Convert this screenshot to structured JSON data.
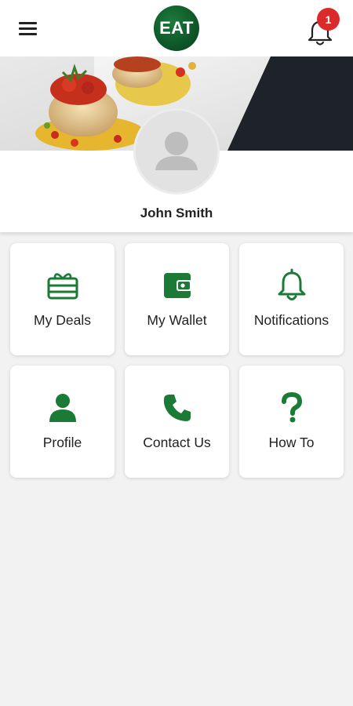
{
  "header": {
    "menu_icon": "hamburger-menu-icon",
    "logo_text": "EAT",
    "notification_icon": "bell-icon",
    "notification_count": "1",
    "accent_color": "#0f5a2a",
    "badge_color": "#d92b2b"
  },
  "profile": {
    "avatar_icon": "person-placeholder-icon",
    "name": "John Smith"
  },
  "menu": {
    "icon_color": "#1b7a36",
    "tiles": [
      {
        "label": "My Deals",
        "icon": "gift-card-icon"
      },
      {
        "label": "My Wallet",
        "icon": "wallet-icon"
      },
      {
        "label": "Notifications",
        "icon": "bell-icon"
      },
      {
        "label": "Profile",
        "icon": "person-icon"
      },
      {
        "label": "Contact Us",
        "icon": "phone-icon"
      },
      {
        "label": "How To",
        "icon": "question-mark-icon"
      }
    ]
  }
}
